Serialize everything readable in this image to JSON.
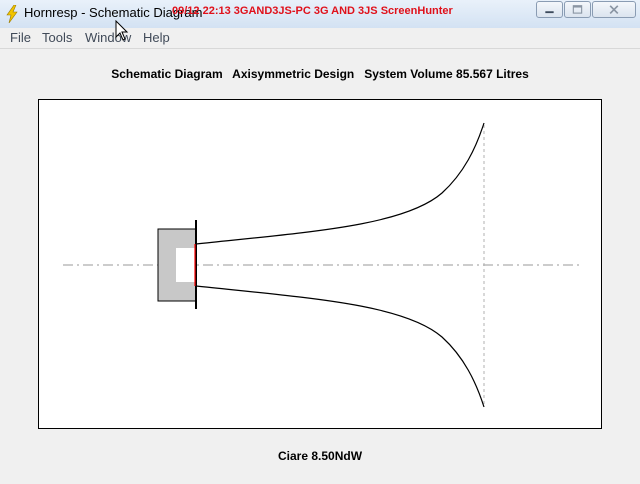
{
  "window": {
    "title": "Hornresp - Schematic Diagram",
    "overlay": "09/12  22:13  3GAND3JS-PC  3G AND 3JS  ScreenHunter"
  },
  "menu": {
    "file": "File",
    "tools": "Tools",
    "window": "Window",
    "help": "Help"
  },
  "diagram": {
    "heading": "Schematic Diagram   Axisymmetric Design   System Volume 85.567 Litres",
    "caption": "Ciare 8.50NdW"
  },
  "colors": {
    "chamber_fill": "#c8c8c8",
    "driver_line": "#ff0000",
    "overlay_text": "#e0101a"
  },
  "icons": {
    "app": "lightning-icon",
    "minimize": "minimize-icon",
    "maximize": "maximize-icon",
    "close": "close-icon",
    "cursor": "mouse-pointer-icon"
  }
}
